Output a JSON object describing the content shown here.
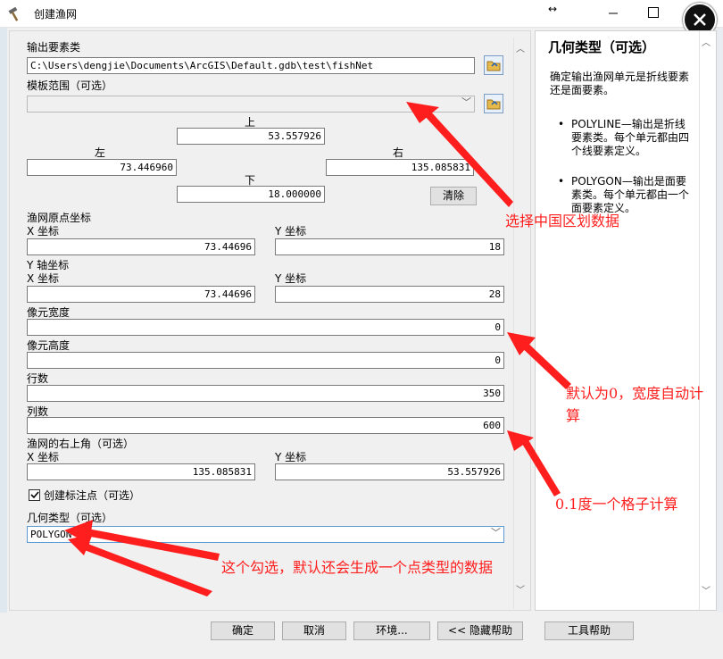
{
  "window": {
    "title": "创建渔网"
  },
  "form": {
    "output_label": "输出要素类",
    "output_value": "C:\\Users\\dengjie\\Documents\\ArcGIS\\Default.gdb\\test\\fishNet",
    "template_label": "模板范围（可选）",
    "extent": {
      "top_label": "上",
      "top": "53.557926",
      "left_label": "左",
      "left": "73.446960",
      "right_label": "右",
      "right": "135.085831",
      "bottom_label": "下",
      "bottom": "18.000000",
      "clear_label": "清除"
    },
    "origin_label": "渔网原点坐标",
    "origin_x_label": "X 坐标",
    "origin_x": "73.44696",
    "origin_y_label": "Y 坐标",
    "origin_y": "18",
    "yaxis_label": "Y 轴坐标",
    "yaxis_x_label": "X 坐标",
    "yaxis_x": "73.44696",
    "yaxis_y_label": "Y 坐标",
    "yaxis_y": "28",
    "cell_width_label": "像元宽度",
    "cell_width": "0",
    "cell_height_label": "像元高度",
    "cell_height": "0",
    "rows_label": "行数",
    "rows": "350",
    "cols_label": "列数",
    "cols": "600",
    "corner_label": "渔网的右上角（可选）",
    "corner_x_label": "X 坐标",
    "corner_x": "135.085831",
    "corner_y_label": "Y 坐标",
    "corner_y": "53.557926",
    "label_points_label": "创建标注点（可选）",
    "geometry_label": "几何类型（可选）",
    "geometry_value": "POLYGON"
  },
  "help": {
    "title": "几何类型（可选）",
    "desc": "确定输出渔网单元是折线要素还是面要素。",
    "bullets": [
      "POLYLINE—输出是折线要素类。每个单元都由四个线要素定义。",
      "POLYGON—输出是面要素类。每个单元都由一个面要素定义。"
    ]
  },
  "buttons": {
    "ok": "确定",
    "cancel": "取消",
    "env": "环境...",
    "hide_help": "<< 隐藏帮助",
    "tool_help": "工具帮助"
  },
  "annotations": {
    "a1": "选择中国区划数据",
    "a2": "默认为0，宽度自动计算",
    "a3": "0.1度一个格子计算",
    "a4": "这个勾选，默认还会生成一个点类型的数据"
  },
  "colors": {
    "annotation": "#ff1e1e",
    "title_bar": "#ffffff",
    "close_button": "#000000"
  }
}
